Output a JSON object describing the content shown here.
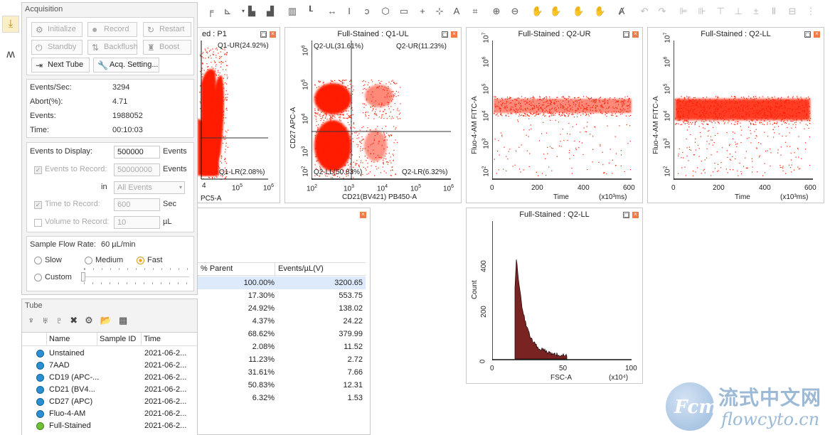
{
  "acquisition": {
    "title": "Acquisition",
    "buttons": {
      "initialize": "Initialize",
      "record": "Record",
      "restart": "Restart",
      "standby": "Standby",
      "backflush": "Backflush",
      "boost": "Boost",
      "next_tube": "Next Tube",
      "acq_setting": "Acq. Setting..."
    },
    "stats": [
      {
        "label": "Events/Sec:",
        "value": "3294"
      },
      {
        "label": "Abort(%):",
        "value": "4.71"
      },
      {
        "label": "Events:",
        "value": "1988052"
      },
      {
        "label": "Time:",
        "value": "00:10:03"
      }
    ],
    "events_to_display_label": "Events to Display:",
    "events_to_display_value": "500000",
    "events_unit": "Events",
    "events_to_record_label": "Events to Record:",
    "events_to_record_value": "50000000",
    "in_label": "in",
    "in_value": "All Events",
    "time_to_record_label": "Time to Record:",
    "time_to_record_value": "600",
    "time_unit": "Sec",
    "volume_to_record_label": "Volume to Record:",
    "volume_to_record_value": "10",
    "volume_unit": "µL",
    "flow_rate_label": "Sample Flow Rate:",
    "flow_rate_value": "60 µL/min",
    "radio_slow": "Slow",
    "radio_medium": "Medium",
    "radio_fast": "Fast",
    "radio_custom": "Custom"
  },
  "tube": {
    "title": "Tube",
    "col_name": "Name",
    "col_sample": "Sample ID",
    "col_time": "Time",
    "rows": [
      {
        "name": "Unstained",
        "time": "2021-06-2..."
      },
      {
        "name": "7AAD",
        "time": "2021-06-2..."
      },
      {
        "name": "CD19 (APC-...",
        "time": "2021-06-2..."
      },
      {
        "name": "CD21 (BV4...",
        "time": "2021-06-2..."
      },
      {
        "name": "CD27 (APC)",
        "time": "2021-06-2..."
      },
      {
        "name": "Fluo-4-AM",
        "time": "2021-06-2..."
      },
      {
        "name": "Full-Stained",
        "time": "2021-06-2..."
      }
    ]
  },
  "plots": {
    "p1": {
      "title": "ed : P1",
      "ur": "Q1-UR(24.92%)",
      "lr": "Q1-LR(2.08%)",
      "xlabel": "PC5-A",
      "xt1": "10",
      "xt2": "10",
      "xt3": "10"
    },
    "q1ul": {
      "title": "Full-Stained : Q1-UL",
      "ul": "Q2-UL(31.61%)",
      "ur": "Q2-UR(11.23%)",
      "ll": "Q2-LL(50.83%)",
      "lr": "Q2-LR(6.32%)",
      "xlabel": "CD21(BV421) PB450-A",
      "ylabel": "CD27 APC-A"
    },
    "q2ur": {
      "title": "Full-Stained : Q2-UR",
      "xlabel": "Time",
      "xunit": "(x10³ms)",
      "ylabel": "Fluo-4-AM FITC-A"
    },
    "q2ll": {
      "title": "Full-Stained : Q2-LL",
      "xlabel": "Time",
      "xunit": "(x10³ms)",
      "ylabel": "Fluo-4-AM FITC-A"
    },
    "hist": {
      "title": "Full-Stained : Q2-LL",
      "xlabel": "FSC-A",
      "xunit": "(x10⁴)",
      "ylabel": "Count"
    }
  },
  "stats_table": {
    "col_parent": "% Parent",
    "col_events": "Events/µL(V)",
    "rows": [
      {
        "parent": "100.00%",
        "events": "3200.65"
      },
      {
        "parent": "17.30%",
        "events": "553.75"
      },
      {
        "parent": "24.92%",
        "events": "138.02"
      },
      {
        "parent": "4.37%",
        "events": "24.22"
      },
      {
        "parent": "68.62%",
        "events": "379.99"
      },
      {
        "parent": "2.08%",
        "events": "11.52"
      },
      {
        "parent": "11.23%",
        "events": "2.72"
      },
      {
        "parent": "31.61%",
        "events": "7.66"
      },
      {
        "parent": "50.83%",
        "events": "12.31"
      },
      {
        "parent": "6.32%",
        "events": "1.53"
      }
    ]
  },
  "watermark": {
    "cn": "流式中文网",
    "url": "flowcyto.cn"
  }
}
